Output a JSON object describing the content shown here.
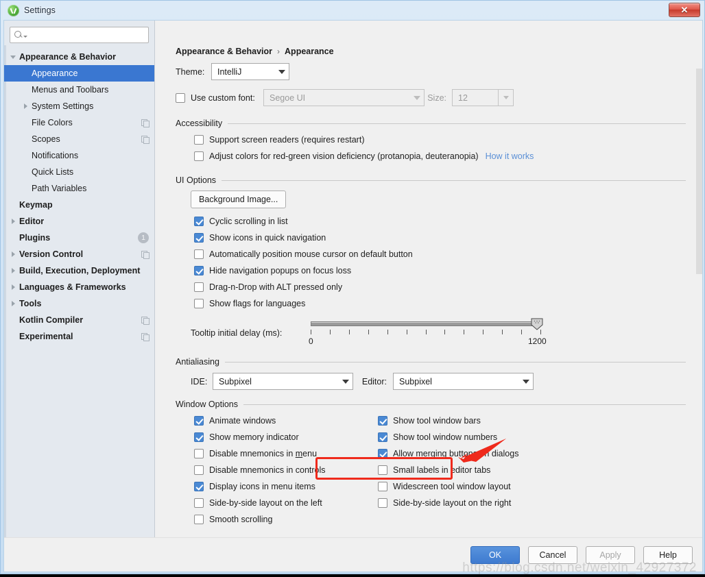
{
  "window": {
    "title": "Settings",
    "app_icon": "android-studio-icon",
    "close_label": "✕"
  },
  "search": {
    "value": "",
    "placeholder": "",
    "icon": "search-icon"
  },
  "sidebar": {
    "items": [
      {
        "label": "Appearance & Behavior",
        "twisty": "down",
        "indent": 0,
        "bold": true,
        "selected": false,
        "icon": ""
      },
      {
        "label": "Appearance",
        "twisty": "none",
        "indent": 1,
        "bold": false,
        "selected": true,
        "icon": ""
      },
      {
        "label": "Menus and Toolbars",
        "twisty": "none",
        "indent": 1,
        "bold": false,
        "selected": false,
        "icon": ""
      },
      {
        "label": "System Settings",
        "twisty": "right",
        "indent": 1,
        "bold": false,
        "selected": false,
        "icon": ""
      },
      {
        "label": "File Colors",
        "twisty": "none",
        "indent": 1,
        "bold": false,
        "selected": false,
        "icon": "copy-icon"
      },
      {
        "label": "Scopes",
        "twisty": "none",
        "indent": 1,
        "bold": false,
        "selected": false,
        "icon": "copy-icon"
      },
      {
        "label": "Notifications",
        "twisty": "none",
        "indent": 1,
        "bold": false,
        "selected": false,
        "icon": ""
      },
      {
        "label": "Quick Lists",
        "twisty": "none",
        "indent": 1,
        "bold": false,
        "selected": false,
        "icon": ""
      },
      {
        "label": "Path Variables",
        "twisty": "none",
        "indent": 1,
        "bold": false,
        "selected": false,
        "icon": ""
      },
      {
        "label": "Keymap",
        "twisty": "none",
        "indent": 0,
        "bold": true,
        "selected": false,
        "icon": ""
      },
      {
        "label": "Editor",
        "twisty": "right",
        "indent": 0,
        "bold": true,
        "selected": false,
        "icon": ""
      },
      {
        "label": "Plugins",
        "twisty": "none",
        "indent": 0,
        "bold": true,
        "selected": false,
        "icon": "badge",
        "badge": "1"
      },
      {
        "label": "Version Control",
        "twisty": "right",
        "indent": 0,
        "bold": true,
        "selected": false,
        "icon": "copy-icon"
      },
      {
        "label": "Build, Execution, Deployment",
        "twisty": "right",
        "indent": 0,
        "bold": true,
        "selected": false,
        "icon": ""
      },
      {
        "label": "Languages & Frameworks",
        "twisty": "right",
        "indent": 0,
        "bold": true,
        "selected": false,
        "icon": ""
      },
      {
        "label": "Tools",
        "twisty": "right",
        "indent": 0,
        "bold": true,
        "selected": false,
        "icon": ""
      },
      {
        "label": "Kotlin Compiler",
        "twisty": "none",
        "indent": 0,
        "bold": true,
        "selected": false,
        "icon": "copy-icon"
      },
      {
        "label": "Experimental",
        "twisty": "none",
        "indent": 0,
        "bold": true,
        "selected": false,
        "icon": "copy-icon"
      }
    ]
  },
  "breadcrumb": {
    "root": "Appearance & Behavior",
    "separator": "›",
    "leaf": "Appearance"
  },
  "theme": {
    "label": "Theme:",
    "value": "IntelliJ"
  },
  "custom_font": {
    "checkbox_label": "Use custom font:",
    "checked": false,
    "font_value": "Segoe UI",
    "size_label": "Size:",
    "size_value": "12",
    "disabled": true
  },
  "accessibility": {
    "title": "Accessibility",
    "options": [
      {
        "label": "Support screen readers (requires restart)",
        "checked": false
      },
      {
        "label": "Adjust colors for red-green vision deficiency (protanopia, deuteranopia)",
        "checked": false
      }
    ],
    "link": "How it works"
  },
  "ui_options": {
    "title": "UI Options",
    "background_image_button": "Background Image...",
    "options": [
      {
        "label": "Cyclic scrolling in list",
        "checked": true
      },
      {
        "label": "Show icons in quick navigation",
        "checked": true
      },
      {
        "label": "Automatically position mouse cursor on default button",
        "checked": false
      },
      {
        "label": "Hide navigation popups on focus loss",
        "checked": true
      },
      {
        "label": "Drag-n-Drop with ALT pressed only",
        "checked": false
      },
      {
        "label": "Show flags for languages",
        "checked": false
      }
    ],
    "tooltip_delay": {
      "label": "Tooltip initial delay (ms):",
      "min": "0",
      "max": "1200",
      "value": 1200,
      "tick_count": 13
    }
  },
  "antialiasing": {
    "title": "Antialiasing",
    "ide_label": "IDE:",
    "ide_value": "Subpixel",
    "editor_label": "Editor:",
    "editor_value": "Subpixel"
  },
  "window_options": {
    "title": "Window Options",
    "left": [
      {
        "label": "Animate windows",
        "checked": true,
        "mnemonic": ""
      },
      {
        "label": "Show memory indicator",
        "checked": true,
        "mnemonic": "",
        "highlighted": true
      },
      {
        "label": "Disable mnemonics in menu",
        "checked": false,
        "mnemonic": "m"
      },
      {
        "label": "Disable mnemonics in controls",
        "checked": false,
        "mnemonic": ""
      },
      {
        "label": "Display icons in menu items",
        "checked": true,
        "mnemonic": ""
      },
      {
        "label": "Side-by-side layout on the left",
        "checked": false,
        "mnemonic": ""
      },
      {
        "label": "Smooth scrolling",
        "checked": false,
        "mnemonic": ""
      }
    ],
    "right": [
      {
        "label": "Show tool window bars",
        "checked": true
      },
      {
        "label": "Show tool window numbers",
        "checked": true
      },
      {
        "label": "Allow merging buttons on dialogs",
        "checked": true
      },
      {
        "label": "Small labels in editor tabs",
        "checked": false
      },
      {
        "label": "Widescreen tool window layout",
        "checked": false
      },
      {
        "label": "Side-by-side layout on the right",
        "checked": false
      }
    ]
  },
  "footer": {
    "ok": "OK",
    "cancel": "Cancel",
    "apply": "Apply",
    "help": "Help"
  },
  "watermark": "https://blog.csdn.net/weixin_42927372",
  "colors": {
    "accent": "#4a89d4",
    "selection": "#3a77d1",
    "annotation": "#ef2a1c",
    "link": "#5a8fd6"
  }
}
